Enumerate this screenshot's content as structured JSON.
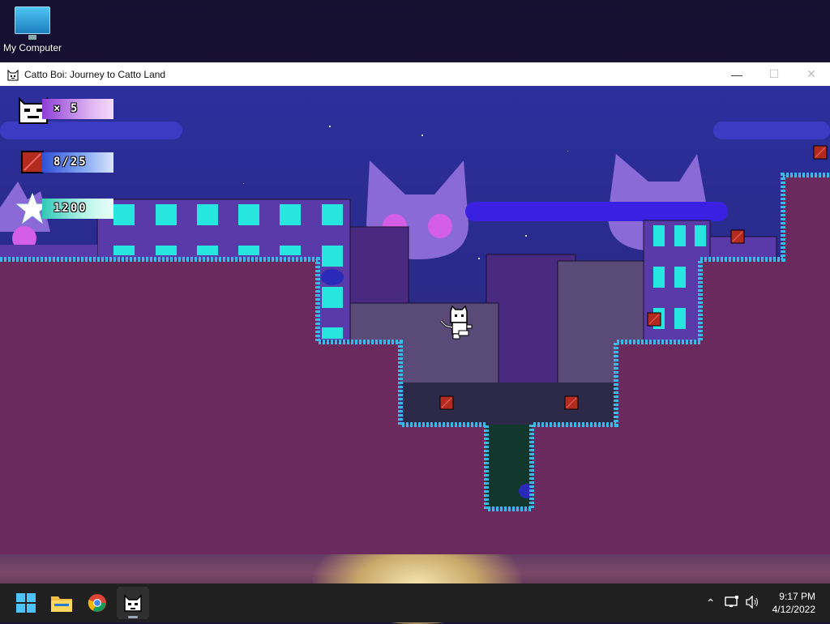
{
  "desktop": {
    "icon_label": "My Computer",
    "icon_name": "computer-monitor-icon"
  },
  "window": {
    "title": "Catto Boi: Journey to Catto Land",
    "controls": [
      "minimize",
      "maximize",
      "close"
    ]
  },
  "hud": {
    "lives_text": "× 5",
    "lives": 5,
    "gems_text": "8/25",
    "gems_collected": 8,
    "gems_total": 25,
    "score_text": "1200",
    "score": 1200
  },
  "colors": {
    "ground": "#6a2a5e",
    "grass_edge": "#3ab8e6",
    "sky": "#2c2f9e",
    "building_purple": "#5a3aa8",
    "window_cyan": "#27e6e0",
    "gem_red": "#b32b1e"
  },
  "taskbar": {
    "apps": [
      "windows-start-icon",
      "file-explorer-icon",
      "chrome-icon",
      "catto-boi-icon"
    ],
    "active_app": "catto-boi-icon",
    "time": "9:17 PM",
    "date": "4/12/2022"
  }
}
